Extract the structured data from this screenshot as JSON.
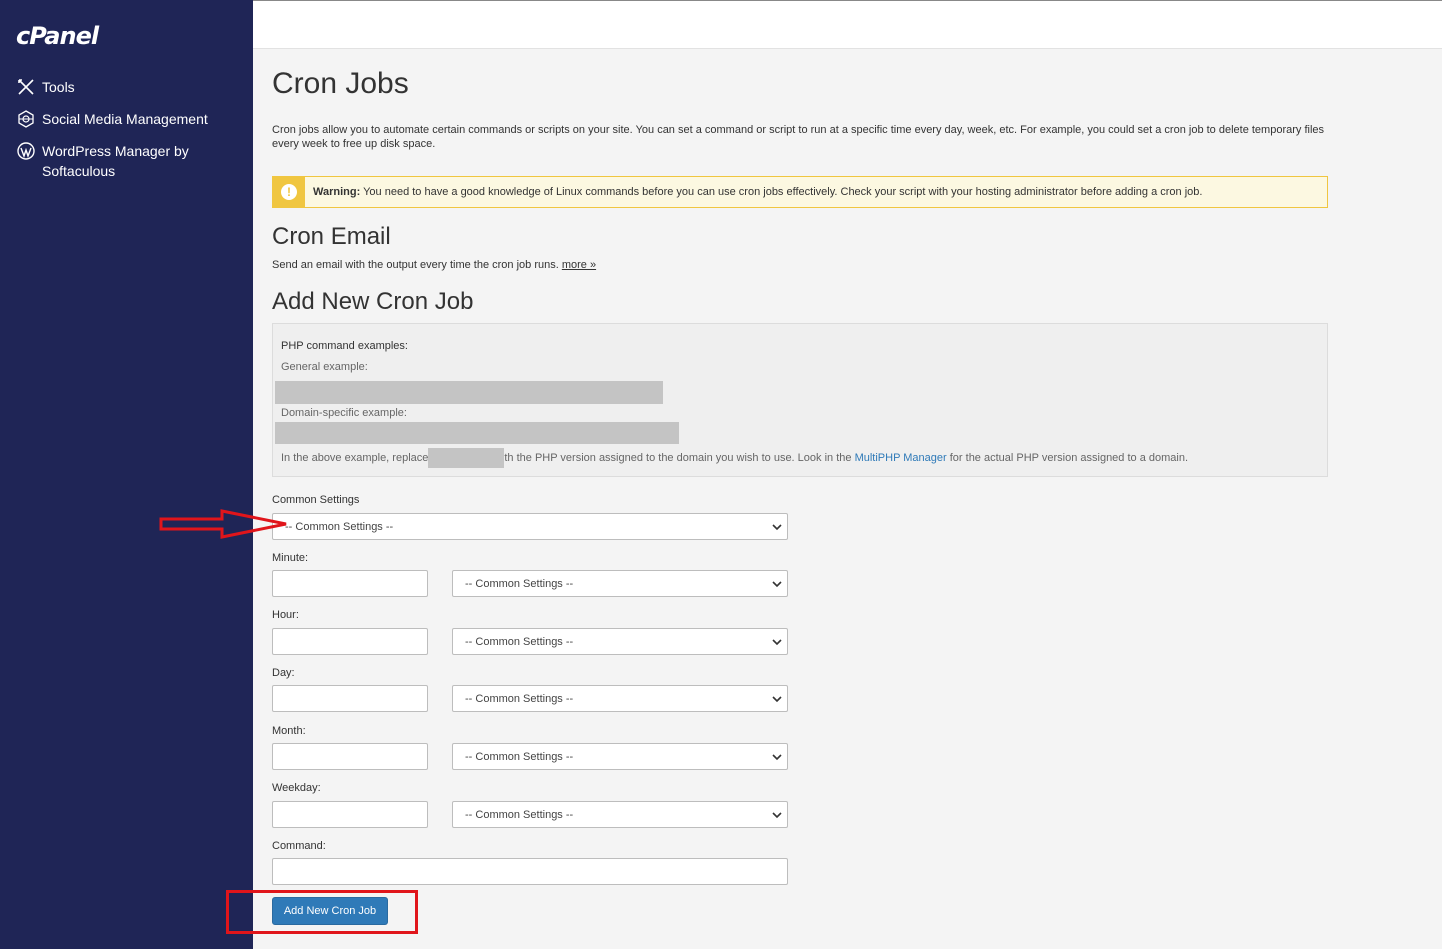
{
  "sidebar": {
    "logo": "cPanel",
    "items": [
      {
        "label": "Tools",
        "icon": "tools-icon"
      },
      {
        "label": "Social Media Management",
        "icon": "social-media-icon"
      },
      {
        "label": "WordPress Manager by Softaculous",
        "icon": "wordpress-icon"
      }
    ]
  },
  "page": {
    "title": "Cron Jobs",
    "intro": "Cron jobs allow you to automate certain commands or scripts on your site. You can set a command or script to run at a specific time every day, week, etc. For example, you could set a cron job to delete temporary files every week to free up disk space.",
    "warning_bold": "Warning:",
    "warning_text": " You need to have a good knowledge of Linux commands before you can use cron jobs effectively. Check your script with your hosting administrator before adding a cron job."
  },
  "cron_email": {
    "heading": "Cron Email",
    "text": "Send an email with the output every time the cron job runs. ",
    "more_link": "more »"
  },
  "add_job": {
    "heading": "Add New Cron Job",
    "examples_title": "PHP command examples:",
    "general_label": "General example:",
    "domain_label": "Domain-specific example:",
    "note_before": "In the above example, replace",
    "note_after": "th the PHP version assigned to the domain you wish to use. Look in the ",
    "note_link": "MultiPHP Manager",
    "note_end": " for the actual PHP version assigned to a domain."
  },
  "form": {
    "common_settings_label": "Common Settings",
    "common_settings_value": "-- Common Settings --",
    "minute_label": "Minute:",
    "hour_label": "Hour:",
    "day_label": "Day:",
    "month_label": "Month:",
    "weekday_label": "Weekday:",
    "command_label": "Command:",
    "select_value": "-- Common Settings --",
    "submit_label": "Add New Cron Job"
  },
  "colors": {
    "sidebar_bg": "#1f2556",
    "primary_button": "#2f7ab8",
    "warning_accent": "#f0c640",
    "annotation_red": "#e0151b"
  }
}
